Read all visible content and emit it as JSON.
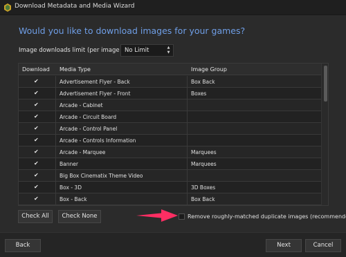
{
  "window": {
    "title": "Download Metadata and Media Wizard"
  },
  "heading": "Would you like to download images for your games?",
  "limit": {
    "label": "Image downloads limit (per image group):",
    "value": "No Limit",
    "up_icon": "triangle-up",
    "down_icon": "triangle-down"
  },
  "grid": {
    "columns": [
      "Download",
      "Media Type",
      "Image Group"
    ],
    "rows": [
      {
        "checked": "✔",
        "media_type": "Advertisement Flyer - Back",
        "image_group": "Box Back"
      },
      {
        "checked": "✔",
        "media_type": "Advertisement Flyer - Front",
        "image_group": "Boxes"
      },
      {
        "checked": "✔",
        "media_type": "Arcade - Cabinet",
        "image_group": ""
      },
      {
        "checked": "✔",
        "media_type": "Arcade - Circuit Board",
        "image_group": ""
      },
      {
        "checked": "✔",
        "media_type": "Arcade - Control Panel",
        "image_group": ""
      },
      {
        "checked": "✔",
        "media_type": "Arcade - Controls Information",
        "image_group": ""
      },
      {
        "checked": "✔",
        "media_type": "Arcade - Marquee",
        "image_group": "Marquees"
      },
      {
        "checked": "✔",
        "media_type": "Banner",
        "image_group": "Marquees"
      },
      {
        "checked": "✔",
        "media_type": "Big Box Cinematix Theme Video",
        "image_group": ""
      },
      {
        "checked": "✔",
        "media_type": "Box - 3D",
        "image_group": "3D Boxes"
      },
      {
        "checked": "✔",
        "media_type": "Box - Back",
        "image_group": "Box Back"
      }
    ]
  },
  "buttons": {
    "check_all": "Check All",
    "check_none": "Check None",
    "back": "Back",
    "next": "Next",
    "cancel": "Cancel"
  },
  "remove_duplicates": {
    "label": "Remove roughly-matched duplicate images (recommended)",
    "checked": false
  },
  "colors": {
    "background": "#2b2b2b",
    "heading": "#6f9ee6",
    "annotation_arrow": "#ff2e63"
  },
  "icons": {
    "app": "launchbox-icon",
    "annotation": "arrow-pointing-right"
  }
}
